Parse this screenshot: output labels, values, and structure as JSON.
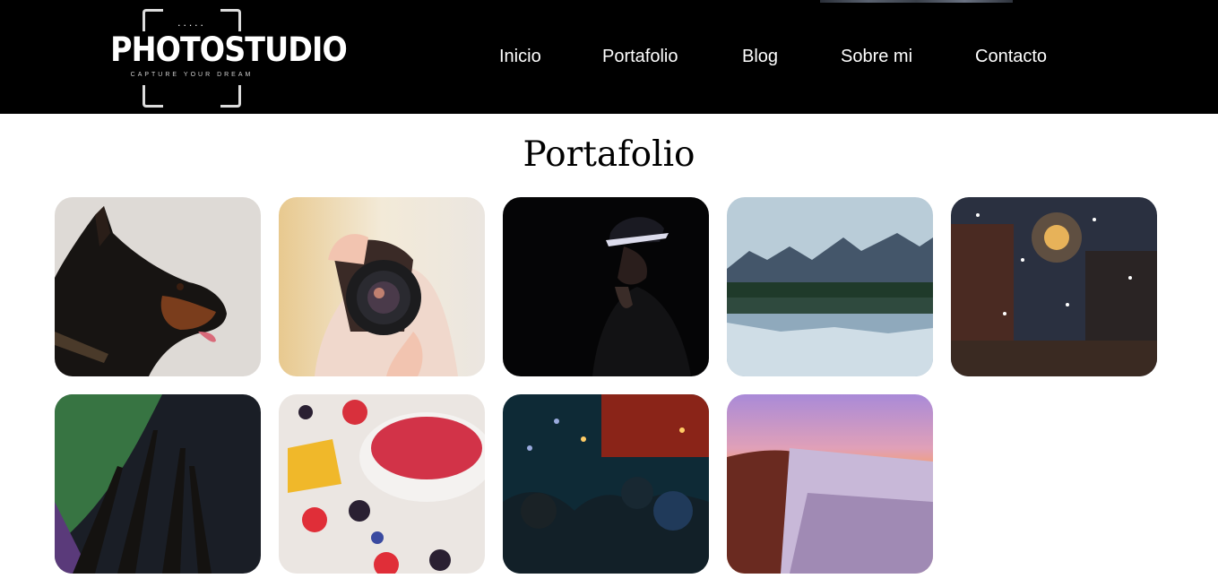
{
  "header": {
    "logo": {
      "dots": ".....",
      "brand": "PHOTOSTUDIO",
      "tagline": "CAPTURE YOUR DREAM"
    },
    "nav": [
      {
        "label": "Inicio"
      },
      {
        "label": "Portafolio"
      },
      {
        "label": "Blog"
      },
      {
        "label": "Sobre mi"
      },
      {
        "label": "Contacto"
      }
    ]
  },
  "main": {
    "title": "Portafolio",
    "gallery": [
      {
        "subject": "doberman dog profile"
      },
      {
        "subject": "woman holding camera"
      },
      {
        "subject": "woman in hat in dark"
      },
      {
        "subject": "mountain lake reflection"
      },
      {
        "subject": "snowy street at night"
      },
      {
        "subject": "northern lights through trees"
      },
      {
        "subject": "fruit bowl with berries"
      },
      {
        "subject": "crowd at night festival"
      },
      {
        "subject": "sunset over hillside village"
      }
    ]
  },
  "colors": {
    "header_bg": "#000000",
    "page_bg": "#ffffff",
    "nav_text": "#ffffff",
    "title_text": "#000000"
  }
}
